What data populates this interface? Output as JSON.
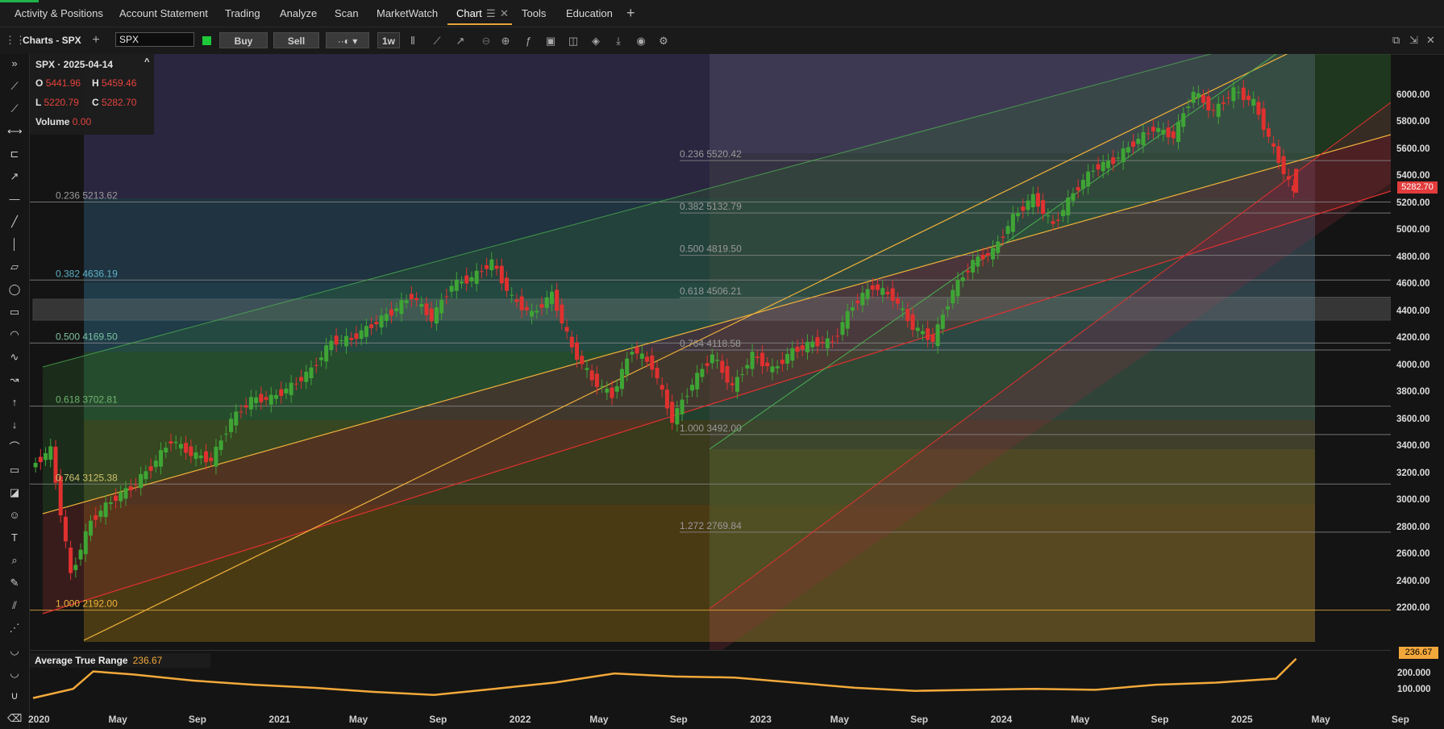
{
  "topnav": {
    "items": [
      "Activity & Positions",
      "Account Statement",
      "Trading",
      "Analyze",
      "Scan",
      "MarketWatch",
      "Chart",
      "Tools",
      "Education"
    ],
    "active": "Chart",
    "add_icon": "plus-icon"
  },
  "toolbar": {
    "title": "Charts - SPX",
    "symbol": "SPX",
    "buy_label": "Buy",
    "sell_label": "Sell",
    "interval": "1w"
  },
  "ohlc": {
    "symbol_date": "SPX · 2025-04-14",
    "open_label": "O",
    "open": "5441.96",
    "high_label": "H",
    "high": "5459.46",
    "low_label": "L",
    "low": "5220.79",
    "close_label": "C",
    "close": "5282.70",
    "volume_label": "Volume",
    "volume": "0.00"
  },
  "fib_left": [
    {
      "ratio": "0.236",
      "price": "5213.62"
    },
    {
      "ratio": "0.382",
      "price": "4636.19"
    },
    {
      "ratio": "0.500",
      "price": "4169.50"
    },
    {
      "ratio": "0.618",
      "price": "3702.81"
    },
    {
      "ratio": "0.764",
      "price": "3125.38"
    },
    {
      "ratio": "1.000",
      "price": "2192.00"
    }
  ],
  "fib_right": [
    {
      "ratio": "0.236",
      "price": "5520.42"
    },
    {
      "ratio": "0.382",
      "price": "5132.79"
    },
    {
      "ratio": "0.500",
      "price": "4819.50"
    },
    {
      "ratio": "0.618",
      "price": "4506.21"
    },
    {
      "ratio": "0.764",
      "price": "4118.58"
    },
    {
      "ratio": "1.000",
      "price": "3492.00"
    },
    {
      "ratio": "1.272",
      "price": "2769.84"
    }
  ],
  "price_axis": [
    "6000.00",
    "5800.00",
    "5600.00",
    "5400.00",
    "5200.00",
    "5000.00",
    "4800.00",
    "4600.00",
    "4400.00",
    "4200.00",
    "4000.00",
    "3800.00",
    "3600.00",
    "3400.00",
    "3200.00",
    "3000.00",
    "2800.00",
    "2600.00",
    "2400.00",
    "2200.00"
  ],
  "last_price": "5282.70",
  "atr": {
    "label": "Average True Range",
    "value": "236.67",
    "axis": [
      "200.000",
      "100.000"
    ]
  },
  "x_axis": [
    "2020",
    "May",
    "Sep",
    "2021",
    "May",
    "Sep",
    "2022",
    "May",
    "Sep",
    "2023",
    "May",
    "Sep",
    "2024",
    "May",
    "Sep",
    "2025",
    "May",
    "Sep"
  ],
  "colors": {
    "up": "#3fa535",
    "down": "#e0312f",
    "fib_line": "#f0b13a",
    "accent": "#e8a33a"
  },
  "chart_data": {
    "type": "candlestick",
    "symbol": "SPX",
    "interval": "1w",
    "ylim": [
      2100,
      6250
    ],
    "x_range": [
      "2020-01",
      "2025-09"
    ],
    "series": [
      {
        "name": "SPX",
        "points": [
          [
            "2020-01",
            3250
          ],
          [
            "2020-02",
            3380
          ],
          [
            "2020-03",
            2450
          ],
          [
            "2020-04",
            2850
          ],
          [
            "2020-05",
            3000
          ],
          [
            "2020-06",
            3100
          ],
          [
            "2020-07",
            3250
          ],
          [
            "2020-08",
            3450
          ],
          [
            "2020-09",
            3350
          ],
          [
            "2020-10",
            3300
          ],
          [
            "2020-11",
            3600
          ],
          [
            "2020-12",
            3750
          ],
          [
            "2021-01",
            3760
          ],
          [
            "2021-02",
            3850
          ],
          [
            "2021-03",
            3970
          ],
          [
            "2021-04",
            4180
          ],
          [
            "2021-05",
            4200
          ],
          [
            "2021-06",
            4300
          ],
          [
            "2021-07",
            4400
          ],
          [
            "2021-08",
            4520
          ],
          [
            "2021-09",
            4350
          ],
          [
            "2021-10",
            4600
          ],
          [
            "2021-11",
            4650
          ],
          [
            "2021-12",
            4770
          ],
          [
            "2022-01",
            4500
          ],
          [
            "2022-02",
            4380
          ],
          [
            "2022-03",
            4530
          ],
          [
            "2022-04",
            4130
          ],
          [
            "2022-05",
            3900
          ],
          [
            "2022-06",
            3780
          ],
          [
            "2022-07",
            4130
          ],
          [
            "2022-08",
            4000
          ],
          [
            "2022-09",
            3600
          ],
          [
            "2022-10",
            3870
          ],
          [
            "2022-11",
            4080
          ],
          [
            "2022-12",
            3840
          ],
          [
            "2023-01",
            4080
          ],
          [
            "2023-02",
            3970
          ],
          [
            "2023-03",
            4110
          ],
          [
            "2023-04",
            4170
          ],
          [
            "2023-05",
            4180
          ],
          [
            "2023-06",
            4450
          ],
          [
            "2023-07",
            4590
          ],
          [
            "2023-08",
            4510
          ],
          [
            "2023-09",
            4290
          ],
          [
            "2023-10",
            4190
          ],
          [
            "2023-11",
            4560
          ],
          [
            "2023-12",
            4770
          ],
          [
            "2024-01",
            4850
          ],
          [
            "2024-02",
            5100
          ],
          [
            "2024-03",
            5250
          ],
          [
            "2024-04",
            5040
          ],
          [
            "2024-05",
            5280
          ],
          [
            "2024-06",
            5460
          ],
          [
            "2024-07",
            5520
          ],
          [
            "2024-08",
            5650
          ],
          [
            "2024-09",
            5760
          ],
          [
            "2024-10",
            5700
          ],
          [
            "2024-11",
            6030
          ],
          [
            "2024-12",
            5880
          ],
          [
            "2025-01",
            6040
          ],
          [
            "2025-02",
            5950
          ],
          [
            "2025-03",
            5600
          ],
          [
            "2025-04",
            5280
          ]
        ]
      },
      {
        "name": "Average True Range",
        "points": [
          [
            "2020-01",
            45
          ],
          [
            "2020-03",
            90
          ],
          [
            "2020-04",
            175
          ],
          [
            "2020-06",
            160
          ],
          [
            "2020-09",
            130
          ],
          [
            "2020-12",
            110
          ],
          [
            "2021-03",
            95
          ],
          [
            "2021-06",
            75
          ],
          [
            "2021-09",
            60
          ],
          [
            "2021-12",
            90
          ],
          [
            "2022-03",
            120
          ],
          [
            "2022-06",
            165
          ],
          [
            "2022-09",
            150
          ],
          [
            "2022-12",
            145
          ],
          [
            "2023-03",
            120
          ],
          [
            "2023-06",
            95
          ],
          [
            "2023-09",
            80
          ],
          [
            "2023-12",
            85
          ],
          [
            "2024-03",
            90
          ],
          [
            "2024-06",
            85
          ],
          [
            "2024-09",
            110
          ],
          [
            "2024-12",
            120
          ],
          [
            "2025-03",
            140
          ],
          [
            "2025-04",
            236.67
          ]
        ]
      }
    ]
  }
}
